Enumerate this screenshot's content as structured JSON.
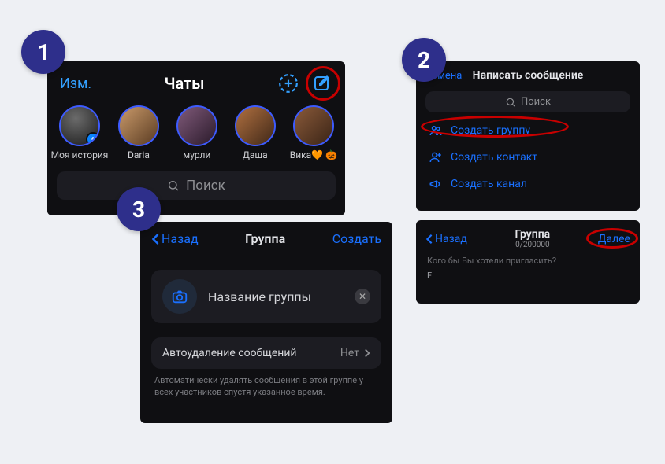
{
  "badges": {
    "one": "1",
    "two": "2",
    "three": "3"
  },
  "panel1": {
    "edit": "Изм.",
    "title": "Чаты",
    "stories": [
      {
        "name": "Моя история",
        "plus": true
      },
      {
        "name": "Daria"
      },
      {
        "name": "мурли"
      },
      {
        "name": "Даша"
      },
      {
        "name": "Вика🧡 🎃"
      }
    ],
    "search_placeholder": "Поиск"
  },
  "panel2": {
    "cancel": "Отмена",
    "title": "Написать сообщение",
    "search_placeholder": "Поиск",
    "rows": {
      "group": "Создать группу",
      "contact": "Создать контакт",
      "channel": "Создать канал"
    }
  },
  "panel4": {
    "back": "Назад",
    "title": "Группа",
    "count": "0/200000",
    "next": "Далее",
    "prompt": "Кого бы Вы хотели пригласить?",
    "kbdhint": "F"
  },
  "panel3": {
    "back": "Назад",
    "title": "Группа",
    "create": "Создать",
    "name_placeholder": "Название группы",
    "autodelete_label": "Автоудаление сообщений",
    "autodelete_value": "Нет",
    "note": "Автоматически удалять сообщения в этой группе у всех участников спустя указанное время."
  }
}
